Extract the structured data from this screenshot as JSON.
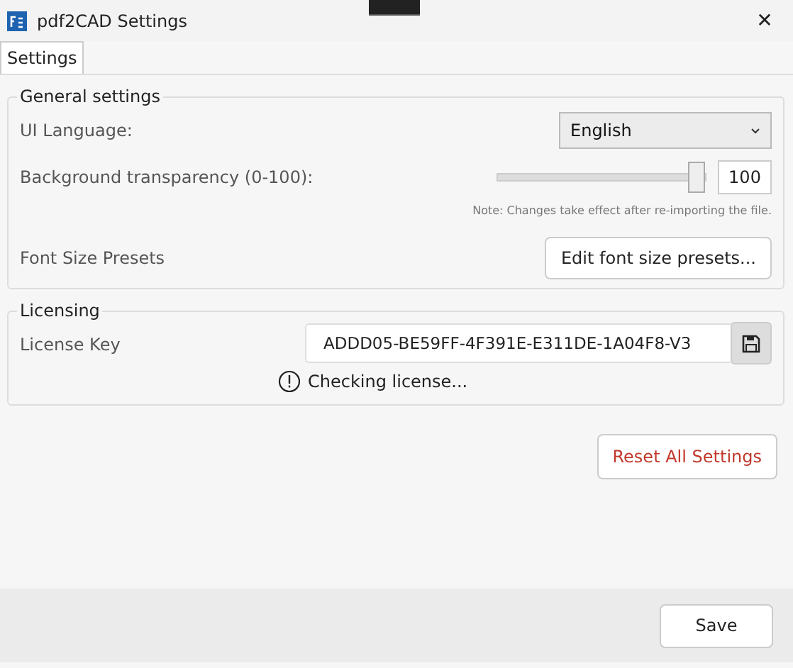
{
  "window": {
    "title": "pdf2CAD Settings",
    "close": "✕"
  },
  "tabs": [
    {
      "label": "Settings",
      "selected": true
    }
  ],
  "general": {
    "title": "General settings",
    "language": {
      "label": "UI Language:",
      "value": "English"
    },
    "transparency": {
      "label": "Background transparency (0-100):",
      "level": 1,
      "value": "100",
      "note": "Note: Changes take effect after re-importing the file."
    },
    "font_presets": {
      "label": "Font Size Presets",
      "button": "Edit font size presets..."
    }
  },
  "licensing": {
    "title": "Licensing",
    "label": "License Key",
    "value": "ADDD05-BE59FF-4F391E-E311DE-1A04F8-V3",
    "status": "Checking license..."
  },
  "reset_button": "Reset All Settings",
  "save_button": "Save"
}
